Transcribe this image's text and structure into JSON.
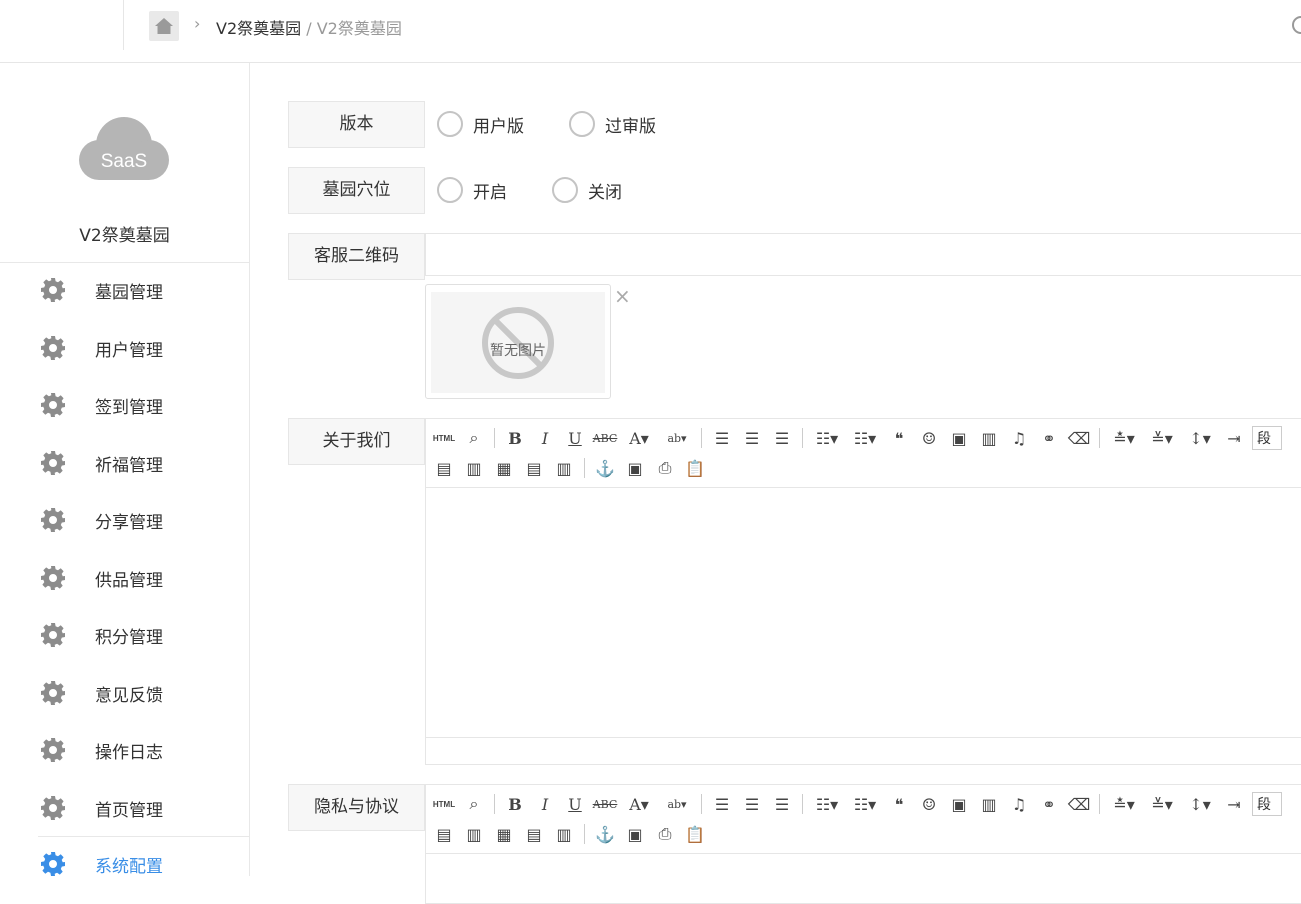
{
  "header": {
    "breadcrumb_parent": "V2祭奠墓园",
    "breadcrumb_sep": "/",
    "breadcrumb_current": "V2祭奠墓园"
  },
  "sidebar": {
    "logo_text": "SaaS",
    "site_name": "V2祭奠墓园",
    "items": [
      {
        "label": "墓园管理",
        "icon": "gear-icon"
      },
      {
        "label": "用户管理",
        "icon": "gear-icon"
      },
      {
        "label": "签到管理",
        "icon": "gear-icon"
      },
      {
        "label": "祈福管理",
        "icon": "gear-icon"
      },
      {
        "label": "分享管理",
        "icon": "gear-icon"
      },
      {
        "label": "供品管理",
        "icon": "gear-icon"
      },
      {
        "label": "积分管理",
        "icon": "gear-icon"
      },
      {
        "label": "意见反馈",
        "icon": "gear-icon"
      },
      {
        "label": "操作日志",
        "icon": "gear-icon"
      },
      {
        "label": "首页管理",
        "icon": "gear-icon"
      },
      {
        "label": "系统配置",
        "icon": "gear-icon",
        "active": true
      }
    ],
    "active_color": "#3a8ee6"
  },
  "form": {
    "version": {
      "label": "版本",
      "options": [
        "用户版",
        "过审版"
      ]
    },
    "cemetery_slots": {
      "label": "墓园穴位",
      "options": [
        "开启",
        "关闭"
      ]
    },
    "service_qr": {
      "label": "客服二维码",
      "value": "",
      "no_image_text": "暂无图片"
    },
    "about_us": {
      "label": "关于我们"
    },
    "privacy": {
      "label": "隐私与协议"
    }
  },
  "editor_toolbar": {
    "html_label": "HTML",
    "paragraph_label": "段"
  }
}
